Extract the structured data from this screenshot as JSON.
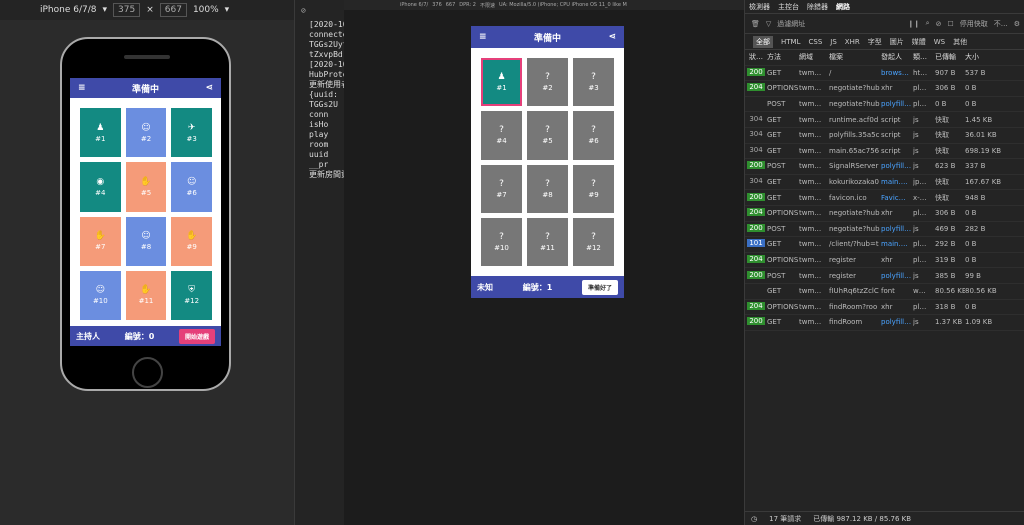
{
  "responsive": {
    "device": "iPhone 6/7/8",
    "width": "375",
    "height": "667",
    "zoom": "100%"
  },
  "preview_toolbar": {
    "device": "iPhone 6/7/",
    "w": "376",
    "h": "667",
    "dpr": "DPR: 2",
    "throttle": "不限速",
    "ua": "UA: Mozilla/5.0 (iPhone; CPU iPhone OS 11_0 like M"
  },
  "app": {
    "title": "準備中",
    "host_label": "主持人",
    "host_number": "編號：0",
    "start_button": "開始遊戲",
    "player_label": "未知",
    "player_number": "編號：1",
    "ready_button": "準備好了"
  },
  "host_tiles": [
    {
      "label": "#1",
      "icon": "♟",
      "color": "#138a82"
    },
    {
      "label": "#2",
      "icon": "☺",
      "color": "#6b8ee0"
    },
    {
      "label": "#3",
      "icon": "✈",
      "color": "#138a82"
    },
    {
      "label": "#4",
      "icon": "◉",
      "color": "#138a82"
    },
    {
      "label": "#5",
      "icon": "✋",
      "color": "#f59b79"
    },
    {
      "label": "#6",
      "icon": "☺",
      "color": "#6b8ee0"
    },
    {
      "label": "#7",
      "icon": "✋",
      "color": "#f59b79"
    },
    {
      "label": "#8",
      "icon": "☺",
      "color": "#6b8ee0"
    },
    {
      "label": "#9",
      "icon": "✋",
      "color": "#f59b79"
    },
    {
      "label": "#10",
      "icon": "☺",
      "color": "#6b8ee0"
    },
    {
      "label": "#11",
      "icon": "✋",
      "color": "#f59b79"
    },
    {
      "label": "#12",
      "icon": "⛨",
      "color": "#138a82"
    }
  ],
  "player_tiles": [
    {
      "label": "#1",
      "icon": "♟",
      "color": "#138a82",
      "selected": true
    },
    {
      "label": "#2",
      "icon": "?",
      "color": "#777777"
    },
    {
      "label": "#3",
      "icon": "?",
      "color": "#777777"
    },
    {
      "label": "#4",
      "icon": "?",
      "color": "#777777"
    },
    {
      "label": "#5",
      "icon": "?",
      "color": "#777777"
    },
    {
      "label": "#6",
      "icon": "?",
      "color": "#777777"
    },
    {
      "label": "#7",
      "icon": "?",
      "color": "#777777"
    },
    {
      "label": "#8",
      "icon": "?",
      "color": "#777777"
    },
    {
      "label": "#9",
      "icon": "?",
      "color": "#777777"
    },
    {
      "label": "#10",
      "icon": "?",
      "color": "#777777"
    },
    {
      "label": "#11",
      "icon": "?",
      "color": "#777777"
    },
    {
      "label": "#12",
      "icon": "?",
      "color": "#777777"
    }
  ],
  "console_lines": [
    "[2020-10",
    "connecte",
    "TGGs2Uyt",
    "tZxvpBd",
    "[2020-10",
    "HubProto",
    "更新使用者",
    "",
    "{uuid:",
    "TGGs2U",
    "",
    "conn",
    "isHo",
    "play",
    "room",
    "uuid",
    "__pr",
    "更新房間資"
  ],
  "network": {
    "tabs": [
      "檢測器",
      "主控台",
      "除錯器",
      "網路"
    ],
    "filter_placeholder": "過濾網址",
    "disable_cache": "停用快取",
    "throttle": "不…",
    "types": [
      "全部",
      "HTML",
      "CSS",
      "JS",
      "XHR",
      "字型",
      "圖片",
      "媒體",
      "WS",
      "其他"
    ],
    "headers": [
      "狀…",
      "方法",
      "網域",
      "檔案",
      "發起人",
      "類…",
      "已傳輸",
      "大小"
    ],
    "rows": [
      {
        "status": "200",
        "method": "GET",
        "domain": "twm…",
        "file": "/",
        "initiator": "brows…",
        "type": "ht…",
        "transferred": "907 B",
        "size": "537 B",
        "blue": true
      },
      {
        "status": "204",
        "method": "OPTIONS",
        "domain": "twm…",
        "file": "negotiate?hub",
        "initiator": "xhr",
        "type": "pl…",
        "transferred": "306 B",
        "size": "0 B"
      },
      {
        "status": "",
        "method": "POST",
        "domain": "twm…",
        "file": "negotiate?hub",
        "initiator": "polyfill…",
        "type": "pl…",
        "transferred": "0 B",
        "size": "0 B",
        "blue": true
      },
      {
        "status": "304",
        "method": "GET",
        "domain": "twm…",
        "file": "runtime.acf0d",
        "initiator": "script",
        "type": "js",
        "transferred": "快取",
        "size": "1.45 KB"
      },
      {
        "status": "304",
        "method": "GET",
        "domain": "twm…",
        "file": "polyfills.35a5c",
        "initiator": "script",
        "type": "js",
        "transferred": "快取",
        "size": "36.01 KB"
      },
      {
        "status": "304",
        "method": "GET",
        "domain": "twm…",
        "file": "main.65ac756",
        "initiator": "script",
        "type": "js",
        "transferred": "快取",
        "size": "698.19 KB"
      },
      {
        "status": "200",
        "method": "POST",
        "domain": "twm…",
        "file": "SignalRServer",
        "initiator": "polyfill…",
        "type": "js",
        "transferred": "623 B",
        "size": "337 B",
        "blue": true
      },
      {
        "status": "304",
        "method": "GET",
        "domain": "twm…",
        "file": "kokurikozaka0",
        "initiator": "main.…",
        "type": "jp…",
        "transferred": "快取",
        "size": "167.67 KB",
        "blue": true
      },
      {
        "status": "200",
        "method": "GET",
        "domain": "twm…",
        "file": "favicon.ico",
        "initiator": "Favic…",
        "type": "x-…",
        "transferred": "快取",
        "size": "948 B",
        "blue": true
      },
      {
        "status": "204",
        "method": "OPTIONS",
        "domain": "twm…",
        "file": "negotiate?hub",
        "initiator": "xhr",
        "type": "pl…",
        "transferred": "306 B",
        "size": "0 B"
      },
      {
        "status": "200",
        "method": "POST",
        "domain": "twm…",
        "file": "negotiate?hub",
        "initiator": "polyfill…",
        "type": "js",
        "transferred": "469 B",
        "size": "282 B",
        "blue": true
      },
      {
        "status": "101",
        "method": "GET",
        "domain": "twm…",
        "file": "/client/?hub=t",
        "initiator": "main.…",
        "type": "pl…",
        "transferred": "292 B",
        "size": "0 B",
        "blue": true
      },
      {
        "status": "204",
        "method": "OPTIONS",
        "domain": "twm…",
        "file": "register",
        "initiator": "xhr",
        "type": "pl…",
        "transferred": "319 B",
        "size": "0 B"
      },
      {
        "status": "200",
        "method": "POST",
        "domain": "twm…",
        "file": "register",
        "initiator": "polyfill…",
        "type": "js",
        "transferred": "385 B",
        "size": "99 B",
        "blue": true
      },
      {
        "status": "",
        "method": "GET",
        "domain": "twm…",
        "file": "fIUhRq6tzZclC",
        "initiator": "font",
        "type": "w…",
        "transferred": "80.56 KB",
        "size": "80.56 KB"
      },
      {
        "status": "204",
        "method": "OPTIONS",
        "domain": "twm…",
        "file": "findRoom?roo",
        "initiator": "xhr",
        "type": "pl…",
        "transferred": "318 B",
        "size": "0 B"
      },
      {
        "status": "200",
        "method": "GET",
        "domain": "twm…",
        "file": "findRoom",
        "initiator": "polyfill…",
        "type": "js",
        "transferred": "1.37 KB",
        "size": "1.09 KB",
        "blue": true
      }
    ],
    "summary_requests": "17 筆請求",
    "summary_transferred": "已傳輸 987.12 KB / 85.76 KB"
  }
}
